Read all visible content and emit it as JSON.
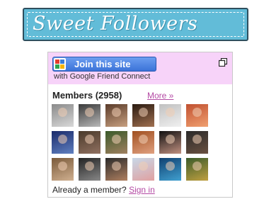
{
  "banner": {
    "title": "Sweet Followers"
  },
  "widget": {
    "join_button_label": "Join this site",
    "join_button_icon": "google-friend-connect-icon",
    "subtitle": "with Google Friend Connect",
    "members_heading": "Members (2958)",
    "more_link": "More »",
    "footer_prefix": "Already a member?",
    "signin_link": "Sign in",
    "colors": {
      "banner_bg": "#62bcd8",
      "header_bg": "#f7d3f9",
      "link": "#b44aa4",
      "button": "#3b73d8"
    },
    "avatars": [
      {
        "colors": [
          "#8a8a8a",
          "#d8d8d8"
        ]
      },
      {
        "colors": [
          "#3a3a3a",
          "#b8b8b8"
        ]
      },
      {
        "colors": [
          "#5a3b2a",
          "#c8a080"
        ]
      },
      {
        "colors": [
          "#2a1a10",
          "#a07050"
        ]
      },
      {
        "colors": [
          "#c0c0c0",
          "#f0f0f0"
        ]
      },
      {
        "colors": [
          "#c05030",
          "#f0a070"
        ]
      },
      {
        "colors": [
          "#1a2a6a",
          "#6080c0"
        ]
      },
      {
        "colors": [
          "#4a3a2a",
          "#907060"
        ]
      },
      {
        "colors": [
          "#3a5a2a",
          "#a08060"
        ]
      },
      {
        "colors": [
          "#a05020",
          "#e0a080"
        ]
      },
      {
        "colors": [
          "#111111",
          "#c09080"
        ]
      },
      {
        "colors": [
          "#2a2a2a",
          "#6a5040"
        ]
      },
      {
        "colors": [
          "#7a5a3a",
          "#d0b090"
        ]
      },
      {
        "colors": [
          "#222222",
          "#888888"
        ]
      },
      {
        "colors": [
          "#2a2a2a",
          "#b08060"
        ]
      },
      {
        "colors": [
          "#c8d8e8",
          "#e0a0a0"
        ]
      },
      {
        "colors": [
          "#104070",
          "#40a0d0"
        ]
      },
      {
        "colors": [
          "#3a5a2a",
          "#c0a040"
        ]
      }
    ]
  }
}
